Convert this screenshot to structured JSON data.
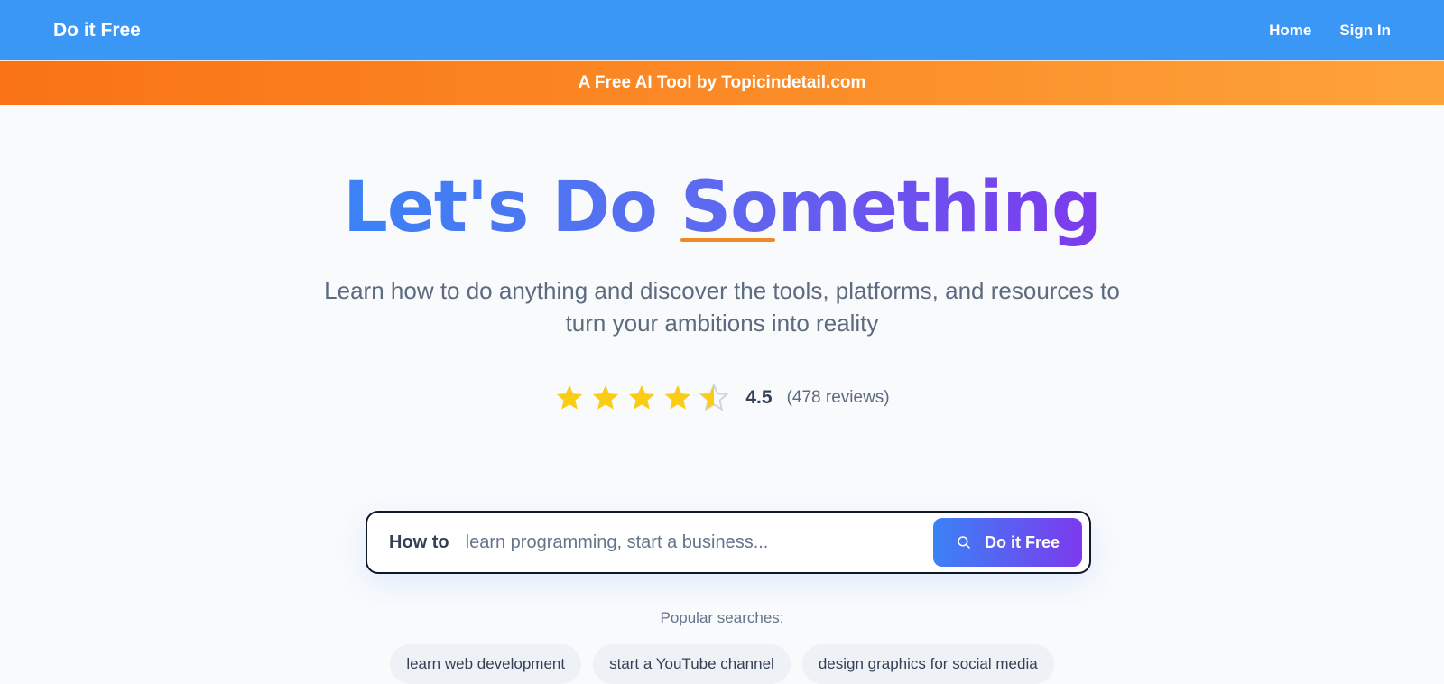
{
  "navbar": {
    "brand": "Do it Free",
    "links": [
      "Home",
      "Sign In"
    ]
  },
  "banner": {
    "text": "A Free AI Tool by Topicindetail.com"
  },
  "hero": {
    "title": "Let's Do Something",
    "subtitle": "Learn how to do anything and discover the tools, platforms, and resources to turn your ambitions into reality"
  },
  "rating": {
    "stars": 4.5,
    "value": "4.5",
    "count": "(478 reviews)"
  },
  "search": {
    "prefix": "How to",
    "placeholder": "learn programming, start a business...",
    "button": "Do it Free"
  },
  "popular": {
    "label": "Popular searches:",
    "items": [
      "learn web development",
      "start a YouTube channel",
      "design graphics for social media"
    ]
  },
  "colors": {
    "navbar": "#3b97f6",
    "banner_start": "#f97316",
    "banner_end": "#fda33a",
    "title_start": "#3b82f6",
    "title_end": "#7c3aed",
    "star": "#facc15",
    "underline": "#f08a24"
  }
}
